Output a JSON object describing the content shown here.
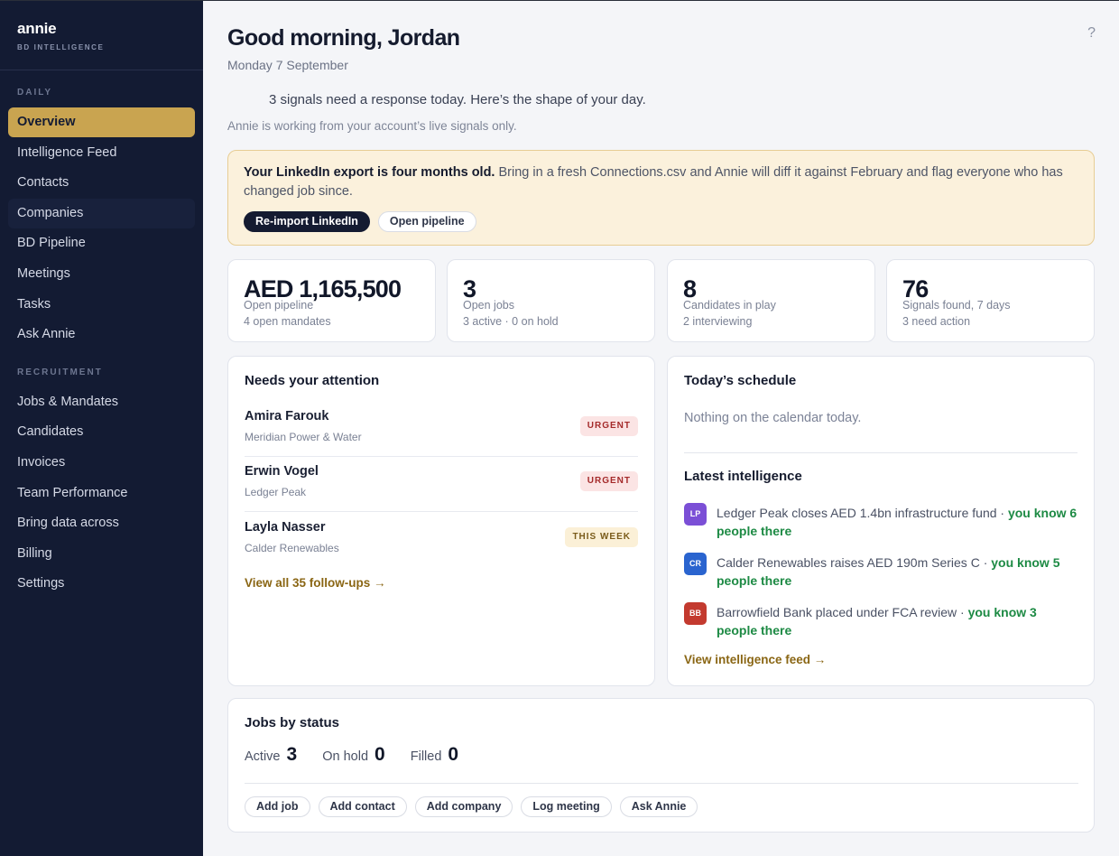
{
  "brand": {
    "name": "annie",
    "sub": "BD INTELLIGENCE"
  },
  "sidebar": {
    "daily_label": "DAILY",
    "recruitment_label": "RECRUITMENT",
    "daily": [
      {
        "label": "Overview"
      },
      {
        "label": "Intelligence Feed"
      },
      {
        "label": "Contacts"
      },
      {
        "label": "Companies"
      },
      {
        "label": "BD Pipeline"
      },
      {
        "label": "Meetings"
      },
      {
        "label": "Tasks"
      },
      {
        "label": "Ask Annie"
      }
    ],
    "recruitment": [
      {
        "label": "Jobs & Mandates"
      },
      {
        "label": "Candidates"
      },
      {
        "label": "Invoices"
      },
      {
        "label": "Team Performance"
      },
      {
        "label": "Bring data across"
      },
      {
        "label": "Billing"
      },
      {
        "label": "Settings"
      }
    ]
  },
  "header": {
    "greeting": "Good morning, Jordan",
    "date": "Monday 7 September",
    "help": "?",
    "summary": "3 signals need a response today. Here’s the shape of your day.",
    "note": "Annie is working from your account’s live signals only."
  },
  "banner": {
    "strong": "Your LinkedIn export is four months old.",
    "text": " Bring in a fresh Connections.csv and Annie will diff it against February and flag everyone who has changed job since.",
    "primary": "Re-import LinkedIn",
    "secondary": "Open pipeline"
  },
  "stats": [
    {
      "value": "AED 1,165,500",
      "label": "Open pipeline",
      "sub": "4 open mandates"
    },
    {
      "value": "3",
      "label": "Open jobs",
      "sub": "3 active · 0 on hold"
    },
    {
      "value": "8",
      "label": "Candidates in play",
      "sub": "2 interviewing"
    },
    {
      "value": "76",
      "label": "Signals found, 7 days",
      "sub": "3 need action"
    }
  ],
  "attention": {
    "title": "Needs your attention",
    "items": [
      {
        "name": "Amira Farouk",
        "org": "Meridian Power & Water",
        "badge": "URGENT"
      },
      {
        "name": "Erwin Vogel",
        "org": "Ledger Peak",
        "badge": "URGENT"
      },
      {
        "name": "Layla Nasser",
        "org": "Calder Renewables",
        "badge": "THIS WEEK"
      }
    ],
    "link": "View all 35 follow-ups →"
  },
  "schedule": {
    "title": "Today’s schedule",
    "empty": "Nothing on the calendar today."
  },
  "intelligence": {
    "title": "Latest intelligence",
    "items": [
      {
        "initials": "LP",
        "color": "#7b4fd6",
        "text": "Ledger Peak closes AED 1.4bn infrastructure fund · ",
        "know": "you know 6 people there"
      },
      {
        "initials": "CR",
        "color": "#2a64cf",
        "text": "Calder Renewables raises AED 190m Series C · ",
        "know": "you know 5 people there"
      },
      {
        "initials": "BB",
        "color": "#c33a2f",
        "text": "Barrowfield Bank placed under FCA review · ",
        "know": "you know 3 people there"
      }
    ],
    "link": "View intelligence feed →"
  },
  "jobs": {
    "title": "Jobs by status",
    "statuses": [
      {
        "label": "Active",
        "count": "3"
      },
      {
        "label": "On hold",
        "count": "0"
      },
      {
        "label": "Filled",
        "count": "0"
      }
    ],
    "actions": [
      "Add job",
      "Add contact",
      "Add company",
      "Log meeting",
      "Ask Annie"
    ]
  }
}
